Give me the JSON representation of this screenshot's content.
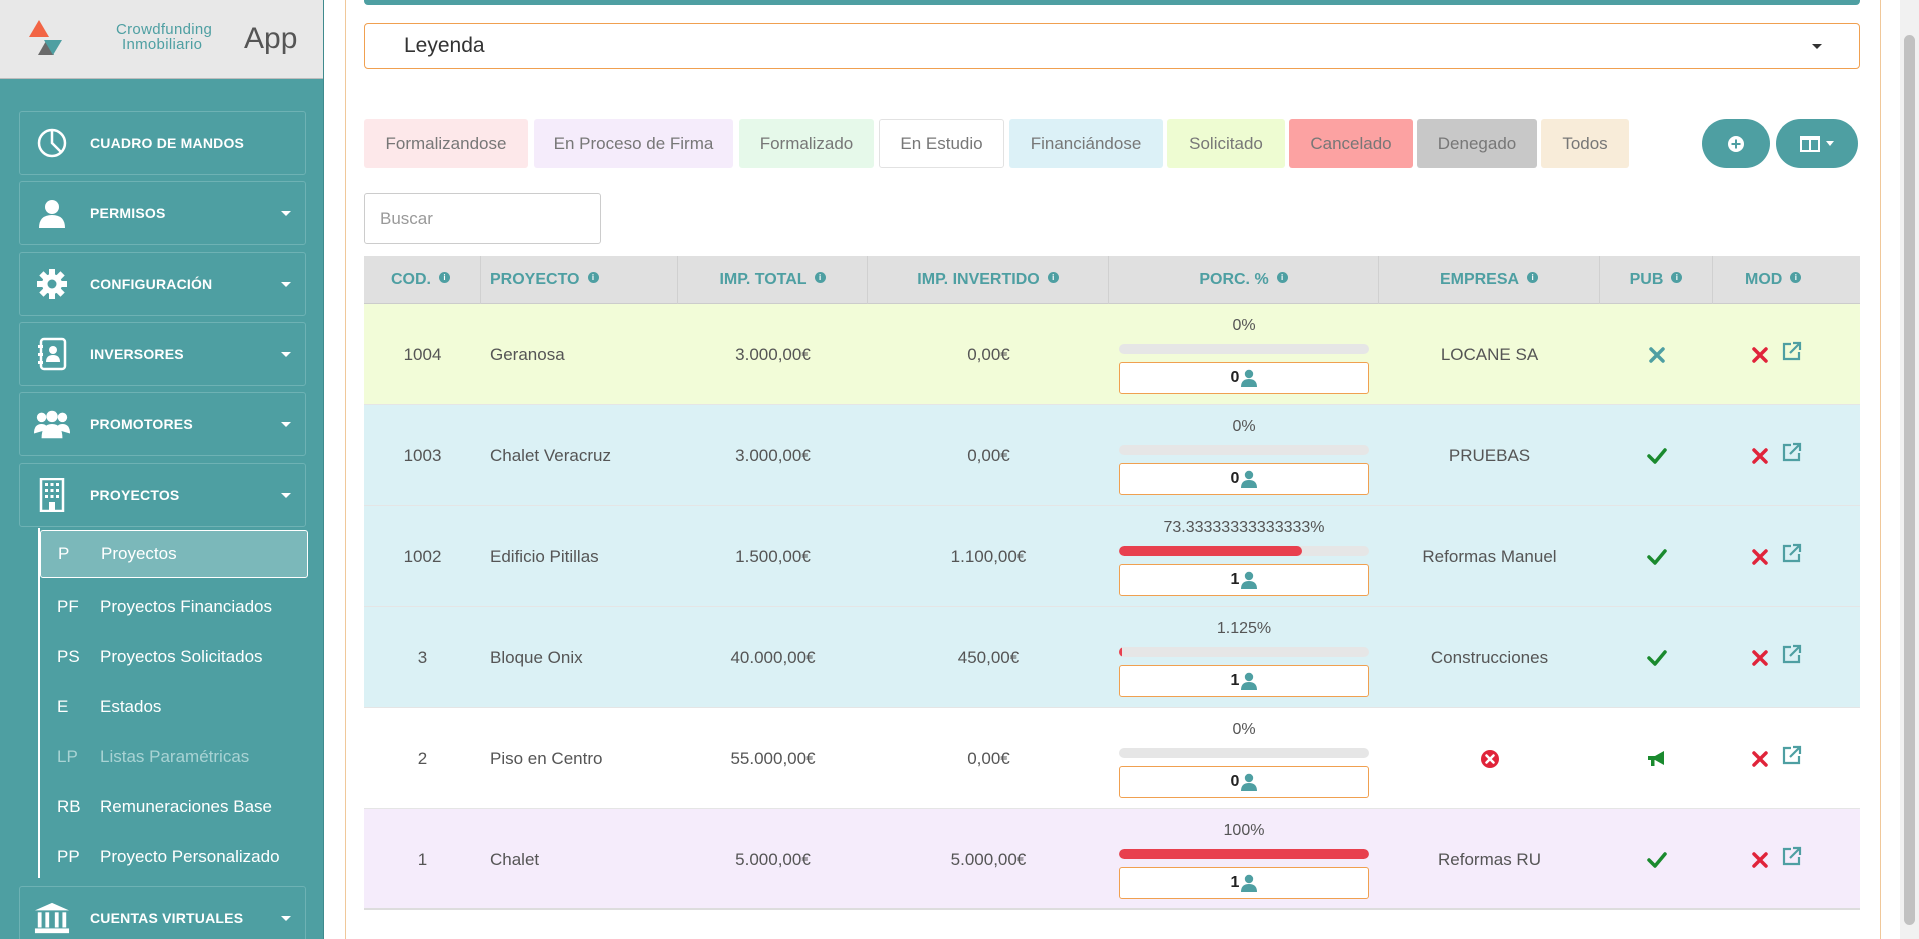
{
  "logo": {
    "line1": "Crowdfunding",
    "line2": "Inmobiliario",
    "line3": "App"
  },
  "sidebar": {
    "items": [
      {
        "label": "CUADRO DE MANDOS",
        "icon": "dashboard-icon"
      },
      {
        "label": "PERMISOS",
        "icon": "user-icon"
      },
      {
        "label": "CONFIGURACIÓN",
        "icon": "gear-icon"
      },
      {
        "label": "INVERSORES",
        "icon": "contact-book-icon"
      },
      {
        "label": "PROMOTORES",
        "icon": "users-icon"
      },
      {
        "label": "PROYECTOS",
        "icon": "building-icon"
      },
      {
        "label": "CUENTAS VIRTUALES",
        "icon": "bank-icon"
      }
    ],
    "submenu": [
      {
        "abbr": "P",
        "label": "Proyectos"
      },
      {
        "abbr": "PF",
        "label": "Proyectos Financiados"
      },
      {
        "abbr": "PS",
        "label": "Proyectos Solicitados"
      },
      {
        "abbr": "E",
        "label": "Estados"
      },
      {
        "abbr": "LP",
        "label": "Listas Paramétricas"
      },
      {
        "abbr": "RB",
        "label": "Remuneraciones Base"
      },
      {
        "abbr": "PP",
        "label": "Proyecto Personalizado"
      }
    ]
  },
  "legend": {
    "label": "Leyenda"
  },
  "filters": [
    {
      "label": "Formalizandose",
      "bg": "#fde8ea"
    },
    {
      "label": "En Proceso de Firma",
      "bg": "#f5ecfb"
    },
    {
      "label": "Formalizado",
      "bg": "#e6f9ea"
    },
    {
      "label": "En Estudio",
      "bg": "#ffffff"
    },
    {
      "label": "Financiándose",
      "bg": "#dcf1f7"
    },
    {
      "label": "Solicitado",
      "bg": "#eefcd2"
    },
    {
      "label": "Cancelado",
      "bg": "#fca2a2"
    },
    {
      "label": "Denegado",
      "bg": "#c8c8c8"
    },
    {
      "label": "Todos",
      "bg": "#f8ecd9"
    }
  ],
  "search": {
    "placeholder": "Buscar"
  },
  "table": {
    "headers": [
      "COD.",
      "PROYECTO",
      "IMP. TOTAL",
      "IMP. INVERTIDO",
      "PORC. %",
      "EMPRESA",
      "PUB",
      "MOD"
    ],
    "rows": [
      {
        "cod": "1004",
        "proyecto": "Geranosa",
        "total": "3.000,00€",
        "invertido": "0,00€",
        "pct_label": "0%",
        "pct": 0,
        "inversores": "0",
        "empresa": "LOCANE SA",
        "pub": "times",
        "bg": "#f2fcd8"
      },
      {
        "cod": "1003",
        "proyecto": "Chalet Veracruz",
        "total": "3.000,00€",
        "invertido": "0,00€",
        "pct_label": "0%",
        "pct": 0,
        "inversores": "0",
        "empresa": "PRUEBAS",
        "pub": "check",
        "bg": "#dbf1f5"
      },
      {
        "cod": "1002",
        "proyecto": "Edificio Pitillas",
        "total": "1.500,00€",
        "invertido": "1.100,00€",
        "pct_label": "73.33333333333333%",
        "pct": 73.33,
        "inversores": "1",
        "empresa": "Reformas Manuel",
        "pub": "check",
        "bg": "#dbf1f5"
      },
      {
        "cod": "3",
        "proyecto": "Bloque Onix",
        "total": "40.000,00€",
        "invertido": "450,00€",
        "pct_label": "1.125%",
        "pct": 1.125,
        "inversores": "1",
        "empresa": "Construcciones",
        "pub": "check",
        "bg": "#dbf1f5"
      },
      {
        "cod": "2",
        "proyecto": "Piso en Centro",
        "total": "55.000,00€",
        "invertido": "0,00€",
        "pct_label": "0%",
        "pct": 0,
        "inversores": "0",
        "empresa": "",
        "empresa_icon": "error",
        "pub": "megaphone",
        "bg": "#ffffff"
      },
      {
        "cod": "1",
        "proyecto": "Chalet",
        "total": "5.000,00€",
        "invertido": "5.000,00€",
        "pct_label": "100%",
        "pct": 100,
        "inversores": "1",
        "empresa": "Reformas RU",
        "pub": "check",
        "bg": "#f5ecfb"
      }
    ]
  },
  "colors": {
    "accent": "#4e9fa2",
    "danger": "#e8404e",
    "success": "#1a8a2e"
  }
}
